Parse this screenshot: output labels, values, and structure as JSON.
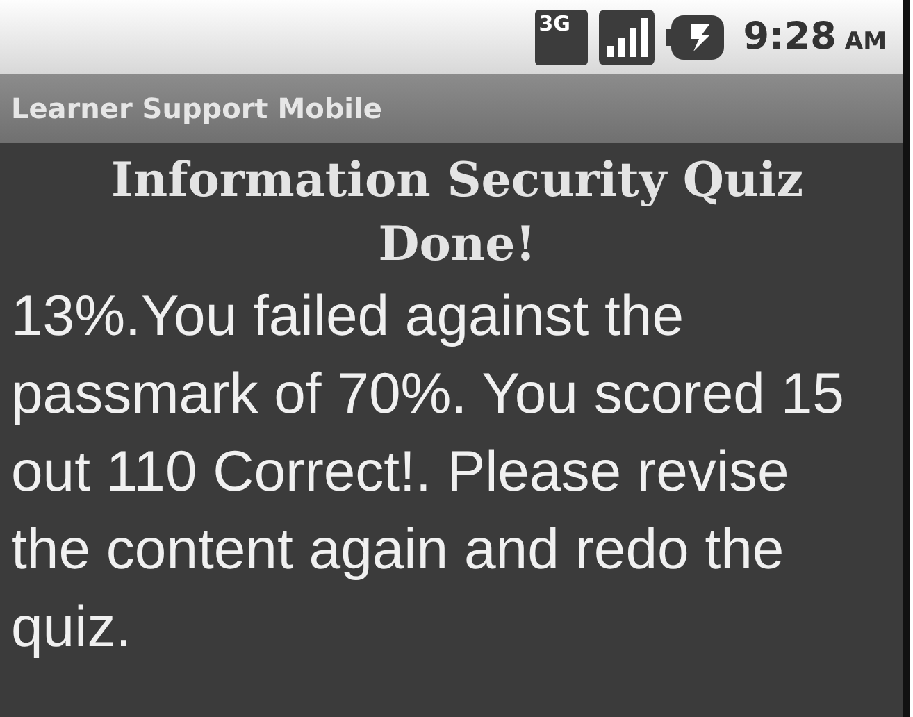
{
  "status_bar": {
    "network": "3G",
    "time": "9:28",
    "ampm": "AM"
  },
  "app_bar": {
    "title": "Learner Support Mobile"
  },
  "content": {
    "heading": "Information Security Quiz Done!",
    "message": "13%.You failed against the passmark of 70%. You scored 15 out 110 Correct!. Please revise the content again and redo the quiz."
  }
}
